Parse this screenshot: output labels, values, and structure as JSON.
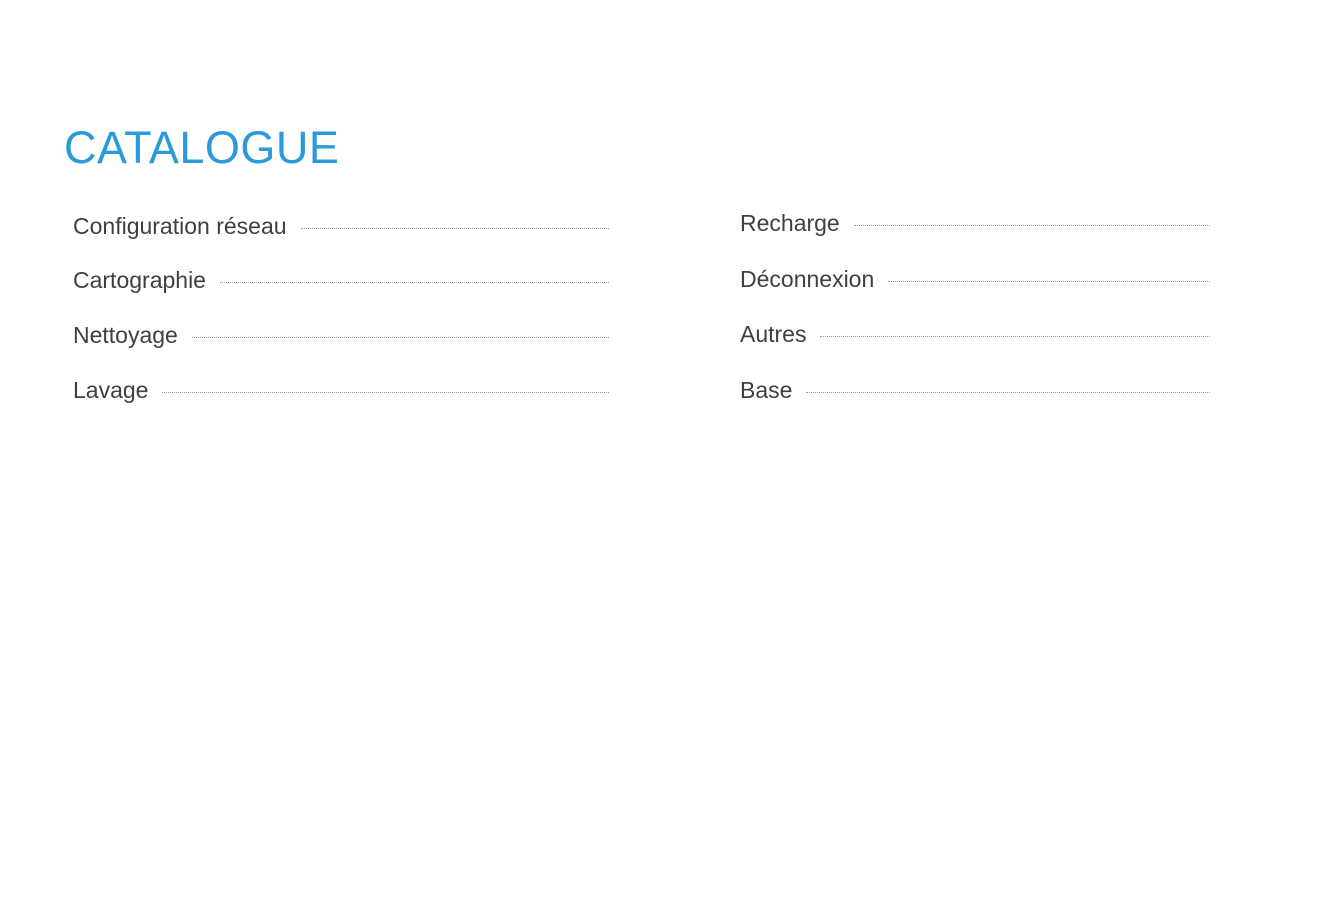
{
  "title": "CATALOGUE",
  "accent_color": "#2b9ad8",
  "text_color": "#3f3f3f",
  "leader_color": "#9a9a9a",
  "toc": {
    "left": [
      {
        "label": "Configuration réseau"
      },
      {
        "label": "Cartographie"
      },
      {
        "label": "Nettoyage"
      },
      {
        "label": "Lavage"
      }
    ],
    "right": [
      {
        "label": "Recharge"
      },
      {
        "label": "Déconnexion"
      },
      {
        "label": "Autres"
      },
      {
        "label": "Base"
      }
    ]
  }
}
